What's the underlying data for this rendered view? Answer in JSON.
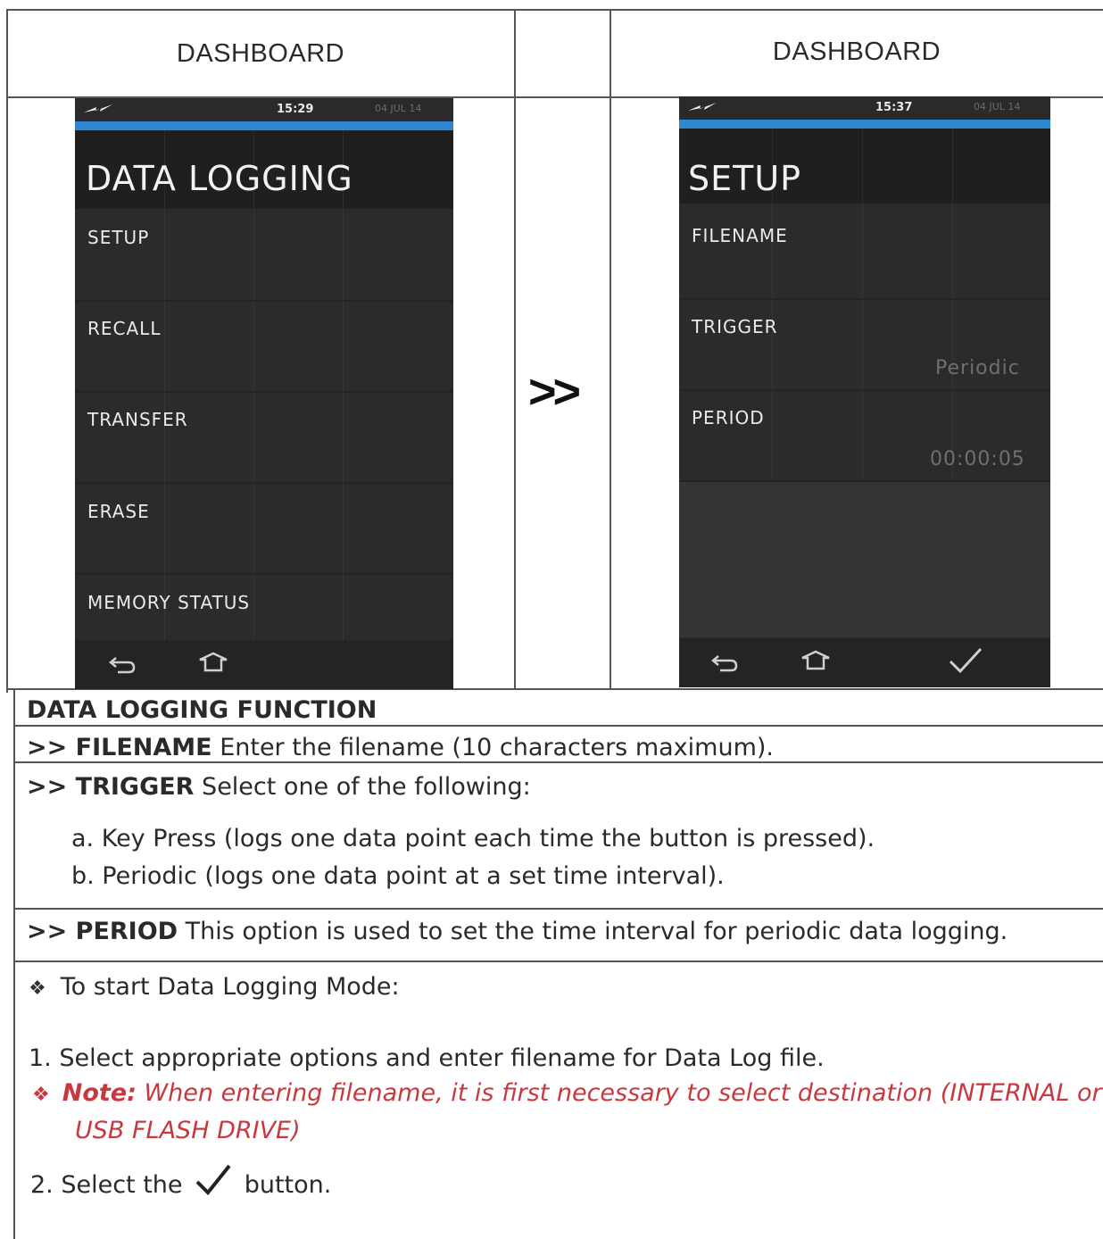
{
  "header": {
    "left_title": "DASHBOARD",
    "right_title": "DASHBOARD"
  },
  "left_screen": {
    "time": "15:29",
    "date": "04 JUL 14",
    "title": "DATA LOGGING",
    "items": [
      "SETUP",
      "RECALL",
      "TRANSFER",
      "ERASE",
      "MEMORY STATUS"
    ],
    "icons": [
      "flash-icon",
      "back-icon",
      "home-icon"
    ]
  },
  "arrow_text": ">>",
  "right_screen": {
    "time": "15:37",
    "date": "04 JUL 14",
    "title": "SETUP",
    "items": [
      "FILENAME",
      "TRIGGER",
      "PERIOD"
    ],
    "trigger_value": "Periodic",
    "period_value": "00:00:05",
    "icons": [
      "flash-icon",
      "back-icon",
      "home-icon",
      "check-icon"
    ]
  },
  "section_title": "DATA LOGGING FUNCTION",
  "filename_row": {
    "prefix": ">> ",
    "key": "FILENAME",
    "text": " Enter the filename (10 characters maximum)."
  },
  "trigger_row": {
    "prefix": ">> ",
    "key": "TRIGGER",
    "text": " Select one of the following:",
    "options": [
      "a. Key Press (logs one data point each time the button is pressed).",
      "b. Periodic (logs one data point at a set time interval)."
    ]
  },
  "period_row": {
    "prefix": ">> ",
    "key": "PERIOD",
    "text": " This option is used to set the time interval for periodic data logging."
  },
  "start_section": {
    "bullet": "❖",
    "heading": "To start Data Logging Mode:",
    "step1": "1. Select appropriate options and enter filename for Data Log file.",
    "note_label": "Note:",
    "note_line1": " When entering filename, it is first necessary to select destination (INTERNAL or",
    "note_line2": "USB FLASH DRIVE)",
    "step2_before": "2. Select the",
    "step2_after": "button."
  },
  "colors": {
    "note": "#c9383f",
    "status_blue": "#2f86d1",
    "screen_bg": "#2b2b2b"
  }
}
